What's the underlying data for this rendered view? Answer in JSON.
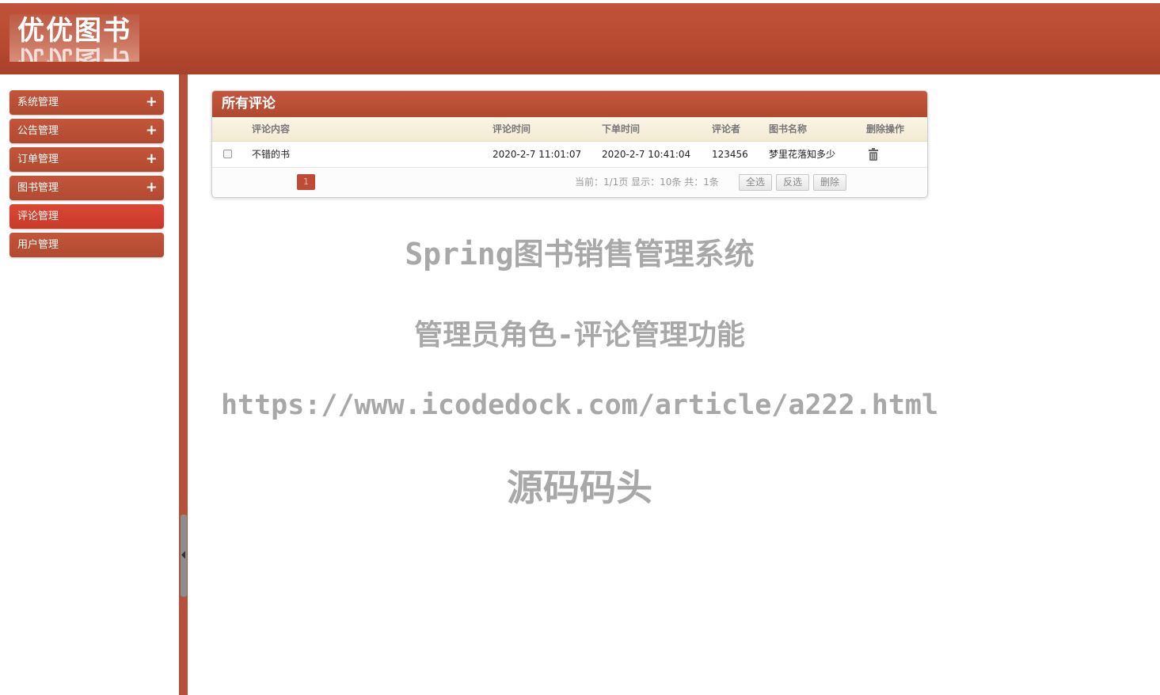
{
  "header": {
    "logo_text": "优优图书"
  },
  "sidebar": {
    "items": [
      {
        "label": "系统管理",
        "expand": "+"
      },
      {
        "label": "公告管理",
        "expand": "+"
      },
      {
        "label": "订单管理",
        "expand": "+"
      },
      {
        "label": "图书管理",
        "expand": "+"
      },
      {
        "label": "评论管理",
        "active": true
      },
      {
        "label": "用户管理"
      }
    ]
  },
  "panel": {
    "title": "所有评论",
    "columns": [
      "评论内容",
      "评论时间",
      "下单时间",
      "评论者",
      "图书名称",
      "删除操作"
    ],
    "rows": [
      {
        "content": "不错的书",
        "comment_time": "2020-2-7 11:01:07",
        "order_time": "2020-2-7 10:41:04",
        "commenter": "123456",
        "book_name": "梦里花落知多少",
        "delete_icon": "trash-icon"
      }
    ],
    "pager": {
      "current_page": "1",
      "info": "当前：1/1页 显示：10条 共：1条",
      "select_all": "全选",
      "invert": "反选",
      "delete": "删除"
    }
  },
  "watermark": {
    "line1": "Spring图书销售管理系统",
    "line2": "管理员角色-评论管理功能",
    "line3": "https://www.icodedock.com/article/a222.html",
    "line4": "源码码头"
  },
  "colors": {
    "brand": "#b84a32",
    "active_menu": "#d64333",
    "table_header": "#f6efdc"
  }
}
